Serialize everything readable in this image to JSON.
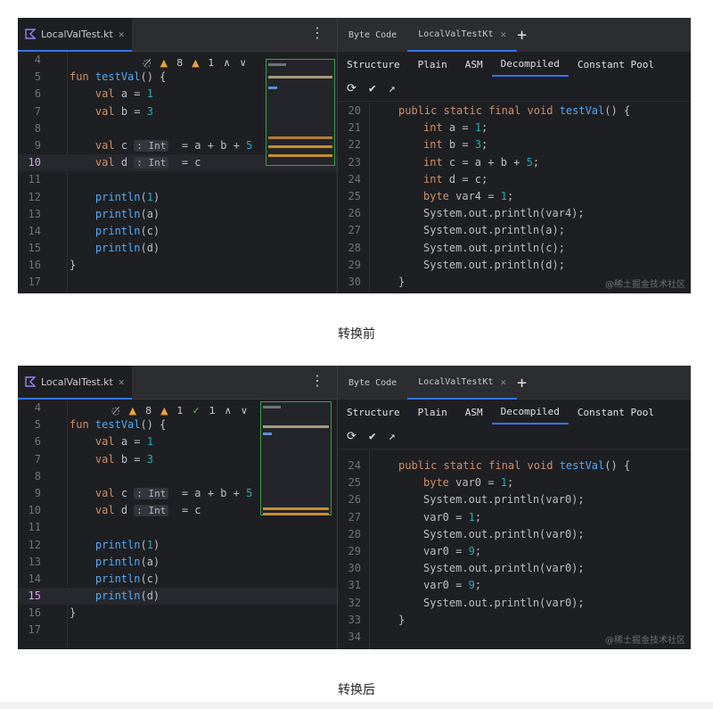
{
  "before": {
    "editor": {
      "file_tab": "LocalValTest.kt",
      "inspections": {
        "warnings": "8",
        "weak_warnings": "1"
      },
      "lines": [
        {
          "n": "4",
          "code": ""
        },
        {
          "n": "5",
          "code": "fun testVal() {"
        },
        {
          "n": "6",
          "code": "    val a = 1"
        },
        {
          "n": "7",
          "code": "    val b = 3"
        },
        {
          "n": "8",
          "code": ""
        },
        {
          "n": "9",
          "code": "    val c : Int  = a + b + 5"
        },
        {
          "n": "10",
          "code": "    val d : Int  = c"
        },
        {
          "n": "11",
          "code": ""
        },
        {
          "n": "12",
          "code": "    println(1)"
        },
        {
          "n": "13",
          "code": "    println(a)"
        },
        {
          "n": "14",
          "code": "    println(c)"
        },
        {
          "n": "15",
          "code": "    println(d)"
        },
        {
          "n": "16",
          "code": "}"
        },
        {
          "n": "17",
          "code": ""
        }
      ]
    },
    "bytecode": {
      "tab_byte_code": "Byte Code",
      "tab_class": "LocalValTestKt",
      "subtabs": [
        "Structure",
        "Plain",
        "ASM",
        "Decompiled",
        "Constant Pool"
      ],
      "lines": [
        {
          "n": "20",
          "code": "public static final void testVal() {"
        },
        {
          "n": "21",
          "code": "int a = 1;"
        },
        {
          "n": "22",
          "code": "int b = 3;"
        },
        {
          "n": "23",
          "code": "int c = a + b + 5;"
        },
        {
          "n": "24",
          "code": "int d = c;"
        },
        {
          "n": "25",
          "code": "byte var4 = 1;"
        },
        {
          "n": "26",
          "code": "System.out.println(var4);"
        },
        {
          "n": "27",
          "code": "System.out.println(a);"
        },
        {
          "n": "28",
          "code": "System.out.println(c);"
        },
        {
          "n": "29",
          "code": "System.out.println(d);"
        },
        {
          "n": "30",
          "code": "}"
        }
      ]
    },
    "watermark": "@稀土掘金技术社区",
    "caption": "转换前"
  },
  "after": {
    "editor": {
      "file_tab": "LocalValTest.kt",
      "inspections": {
        "warnings": "8",
        "weak_warnings": "1",
        "ok": "1"
      },
      "lines": [
        {
          "n": "4",
          "code": ""
        },
        {
          "n": "5",
          "code": "fun testVal() {"
        },
        {
          "n": "6",
          "code": "    val a = 1"
        },
        {
          "n": "7",
          "code": "    val b = 3"
        },
        {
          "n": "8",
          "code": ""
        },
        {
          "n": "9",
          "code": "    val c : Int  = a + b + 5"
        },
        {
          "n": "10",
          "code": "    val d : Int  = c"
        },
        {
          "n": "11",
          "code": ""
        },
        {
          "n": "12",
          "code": "    println(1)"
        },
        {
          "n": "13",
          "code": "    println(a)"
        },
        {
          "n": "14",
          "code": "    println(c)"
        },
        {
          "n": "15",
          "code": "    println(d)"
        },
        {
          "n": "16",
          "code": "}"
        },
        {
          "n": "17",
          "code": ""
        }
      ]
    },
    "bytecode": {
      "tab_byte_code": "Byte Code",
      "tab_class": "LocalValTestKt",
      "subtabs": [
        "Structure",
        "Plain",
        "ASM",
        "Decompiled",
        "Constant Pool"
      ],
      "lines": [
        {
          "n": "24",
          "code": "public static final void testVal() {"
        },
        {
          "n": "25",
          "code": "byte var0 = 1;"
        },
        {
          "n": "26",
          "code": "System.out.println(var0);"
        },
        {
          "n": "27",
          "code": "var0 = 1;"
        },
        {
          "n": "28",
          "code": "System.out.println(var0);"
        },
        {
          "n": "29",
          "code": "var0 = 9;"
        },
        {
          "n": "30",
          "code": "System.out.println(var0);"
        },
        {
          "n": "31",
          "code": "var0 = 9;"
        },
        {
          "n": "32",
          "code": "System.out.println(var0);"
        },
        {
          "n": "33",
          "code": "}"
        },
        {
          "n": "34",
          "code": ""
        }
      ]
    },
    "watermark": "@稀土掘金技术社区",
    "caption": "转换后"
  },
  "colors": {
    "keyword": "#cf8e6d",
    "number": "#2aacb8",
    "function": "#56a8f5",
    "accent": "#3574f0",
    "warning": "#e8a33d"
  }
}
